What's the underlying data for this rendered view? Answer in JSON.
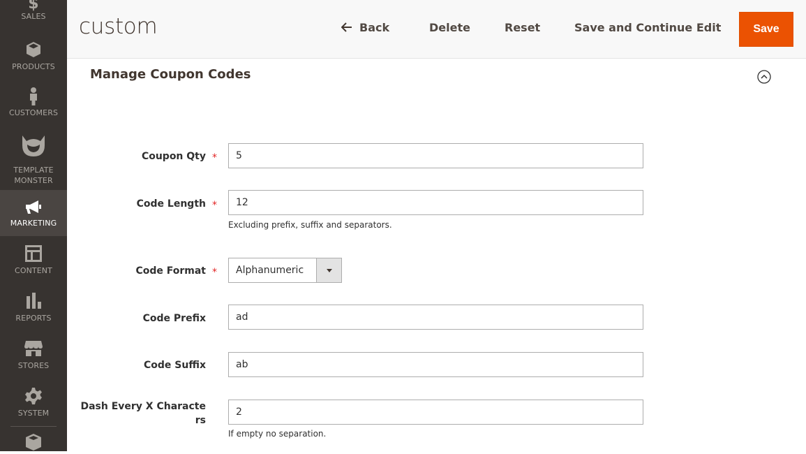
{
  "sidebar": {
    "items": [
      {
        "label": "SALES",
        "icon": "dollar-icon"
      },
      {
        "label": "PRODUCTS",
        "icon": "box-icon"
      },
      {
        "label": "CUSTOMERS",
        "icon": "person-icon"
      },
      {
        "label": "TEMPLATE MONSTER",
        "icon": "monster-icon"
      },
      {
        "label": "MARKETING",
        "icon": "megaphone-icon",
        "active": true
      },
      {
        "label": "CONTENT",
        "icon": "layout-icon"
      },
      {
        "label": "REPORTS",
        "icon": "bar-chart-icon"
      },
      {
        "label": "STORES",
        "icon": "store-icon"
      },
      {
        "label": "SYSTEM",
        "icon": "gear-icon"
      },
      {
        "label": "",
        "icon": "blocks-icon"
      }
    ]
  },
  "header": {
    "title": "custom",
    "back_label": "Back",
    "delete_label": "Delete",
    "reset_label": "Reset",
    "save_continue_label": "Save and Continue Edit",
    "save_label": "Save",
    "accent_color": "#eb5202"
  },
  "section": {
    "title": "Manage Coupon Codes"
  },
  "form": {
    "coupon_qty": {
      "label": "Coupon Qty",
      "value": "5",
      "required": true
    },
    "code_length": {
      "label": "Code Length",
      "value": "12",
      "required": true,
      "note": "Excluding prefix, suffix and separators."
    },
    "code_format": {
      "label": "Code Format",
      "value": "Alphanumeric",
      "required": true
    },
    "code_prefix": {
      "label": "Code Prefix",
      "value": "ad"
    },
    "code_suffix": {
      "label": "Code Suffix",
      "value": "ab"
    },
    "dash_every": {
      "label_line1": "Dash Every X Characte",
      "label_line2": "rs",
      "value": "2",
      "note": "If empty no separation."
    }
  },
  "required_marker": "*"
}
